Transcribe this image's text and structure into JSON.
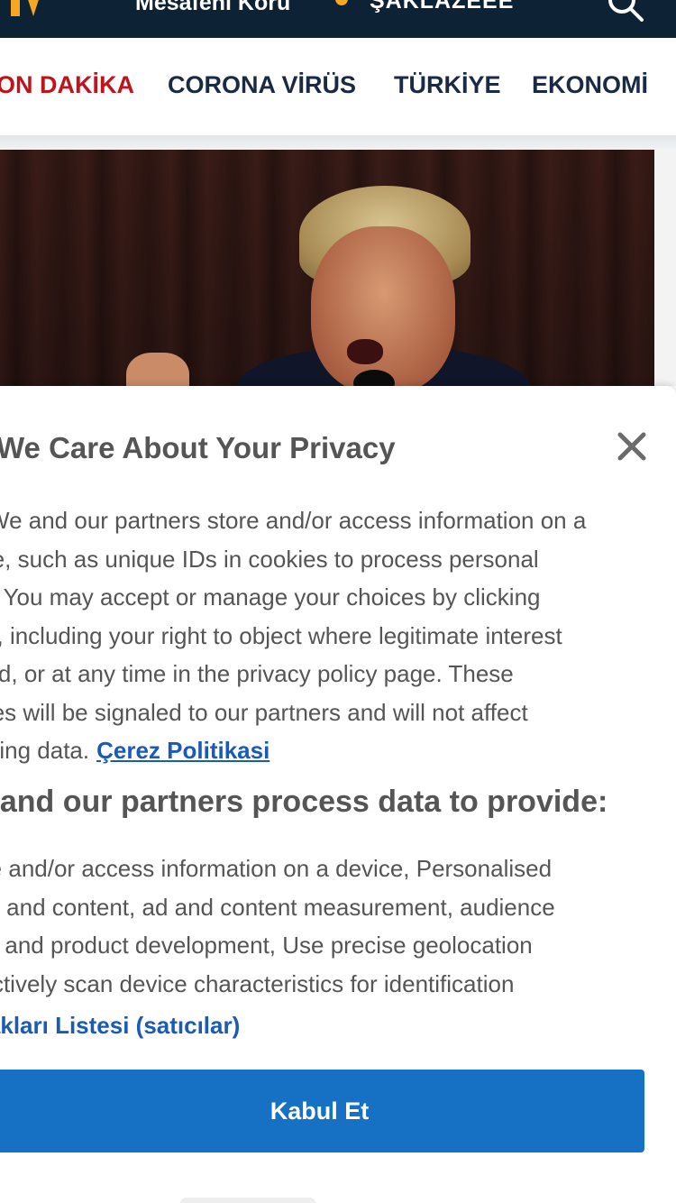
{
  "header": {
    "campaign_text": "Mesafeni Koru",
    "weather_text": "ŞAKLAZEEE",
    "colors": {
      "bar": "#0e2235",
      "accent": "#f7a823"
    },
    "icons": [
      "logo-mark",
      "weather-sun-icon",
      "search-icon"
    ]
  },
  "nav": {
    "items": [
      {
        "label": "SON DAKİKA",
        "highlight": true
      },
      {
        "label": "CORONA VİRÜS",
        "highlight": false
      },
      {
        "label": "TÜRKİYE",
        "highlight": false
      },
      {
        "label": "EKONOMİ",
        "highlight": false
      }
    ],
    "colors": {
      "hot": "#c0141d",
      "default": "#1a2a44"
    }
  },
  "hero": {
    "image_subject": "man speaking at microphone"
  },
  "consent": {
    "title": "We Care About Your Privacy",
    "body_lines": [
      "We and our partners store and/or access information on a",
      "device, such as unique IDs in cookies to process personal",
      "data. You may accept or manage your choices by clicking",
      "below, including your right to object where legitimate interest",
      "is used, or at any time in the privacy policy page. These",
      "choices will be signaled to our partners and will not affect",
      "browsing data."
    ],
    "policy_link": "Çerez Politikasi",
    "subhead": "We and our partners process data to provide:",
    "purpose_lines": [
      "Store and/or access information on a device, Personalised",
      "ads and content, ad and content measurement, audience",
      "insights and product development, Use precise geolocation",
      "data, Actively scan device characteristics for identification"
    ],
    "vendor_link": "İş Ortakları Listesi (satıcılar)",
    "accept_label": "Kabul Et",
    "colors": {
      "button": "#1671c4",
      "link": "#1a5bb8",
      "text": "#555555"
    }
  }
}
